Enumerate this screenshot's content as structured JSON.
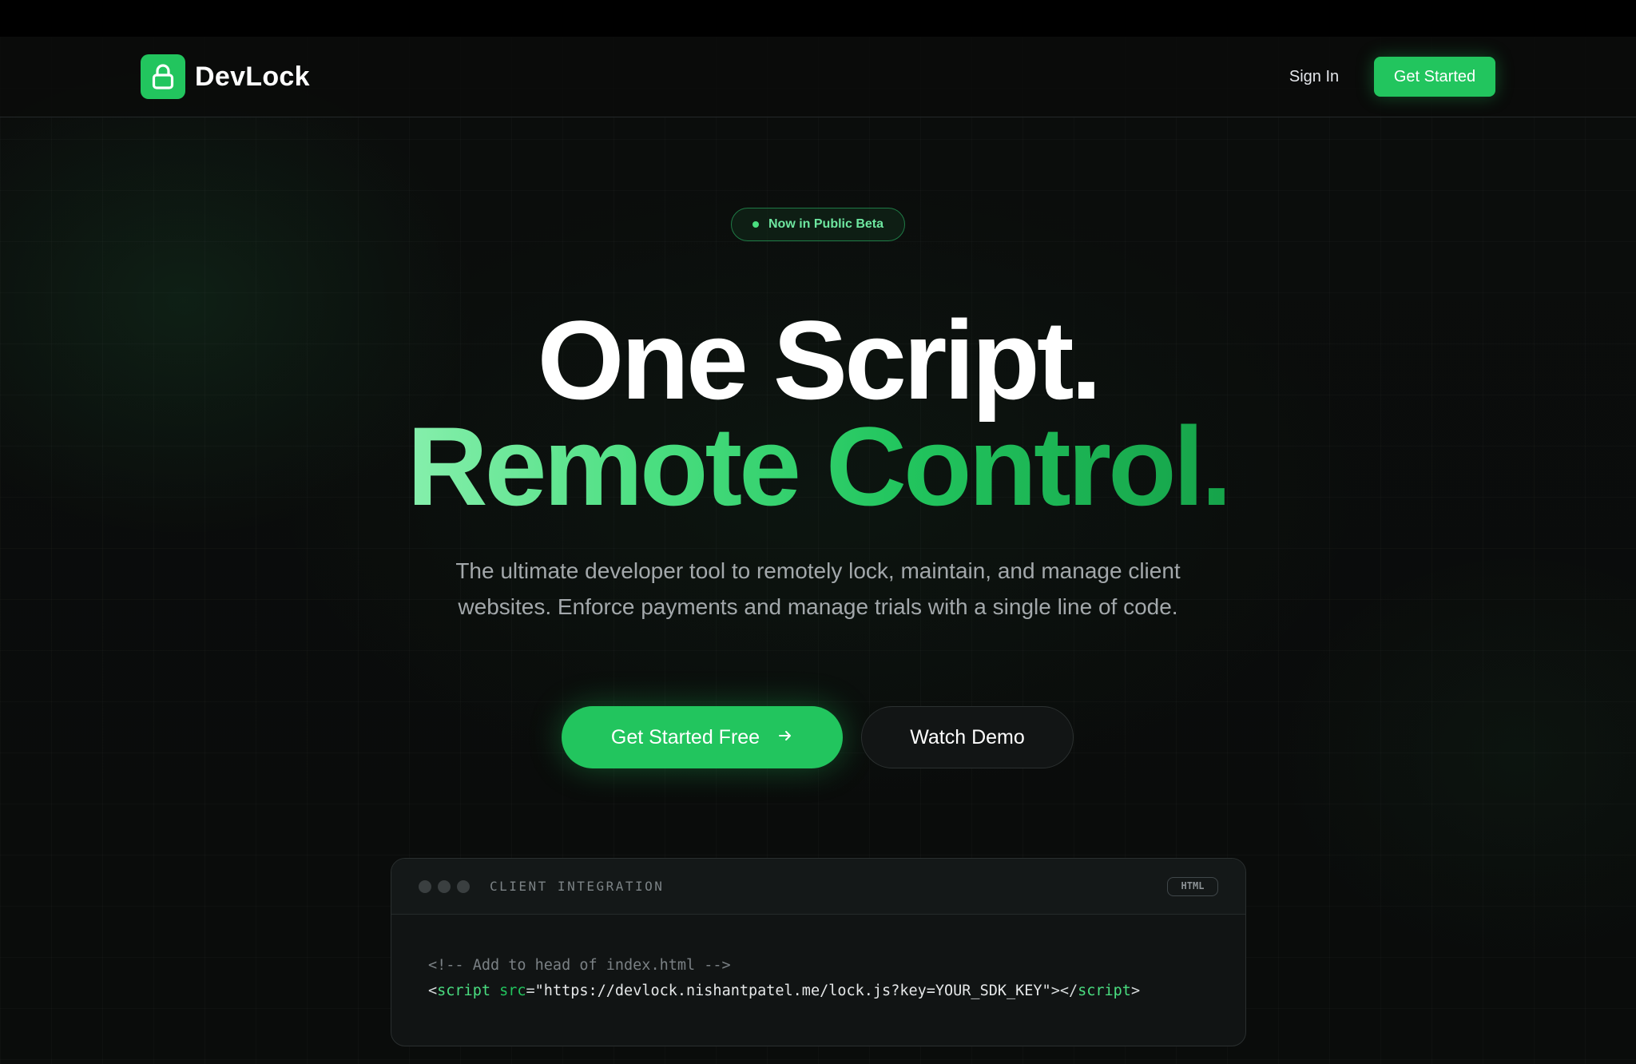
{
  "brand": {
    "name": "DevLock",
    "logo_icon": "lock-icon",
    "accent_color": "#22c55e"
  },
  "nav": {
    "signin_label": "Sign In",
    "cta_label": "Get Started"
  },
  "hero": {
    "badge": "Now in Public Beta",
    "headline_line1": "One Script.",
    "headline_line2": "Remote Control.",
    "subtitle": "The ultimate developer tool to remotely lock, maintain, and manage client websites. Enforce payments and manage trials with a single line of code.",
    "primary_button": "Get Started Free",
    "primary_button_icon": "arrow-right-icon",
    "secondary_button": "Watch Demo"
  },
  "code_card": {
    "title": "CLIENT INTEGRATION",
    "language_badge": "HTML",
    "comment_line": "<!-- Add to head of index.html -->",
    "snippet": {
      "open_bracket": "<",
      "tag": "script",
      "attr": "src",
      "equals": "=",
      "value": "\"https://devlock.nishantpatel.me/lock.js?key=YOUR_SDK_KEY\"",
      "close_open": "></",
      "close_tag": "script",
      "close_bracket": ">"
    }
  }
}
